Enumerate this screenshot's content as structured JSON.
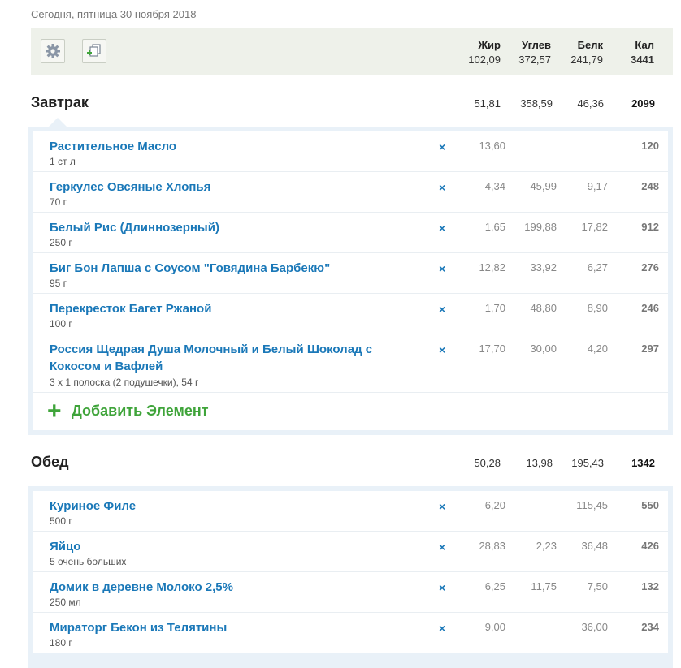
{
  "date": "Сегодня, пятница 30 ноября 2018",
  "toolbar": {
    "settings_icon": "gear-icon",
    "copy_icon": "copy-plus-icon"
  },
  "totals": {
    "headers": {
      "fat": "Жир",
      "carb": "Углев",
      "prot": "Белк",
      "kcal": "Кал"
    },
    "fat": "102,09",
    "carb": "372,57",
    "prot": "241,79",
    "kcal": "3441"
  },
  "breakfast": {
    "title": "Завтрак",
    "fat": "51,81",
    "carb": "358,59",
    "prot": "46,36",
    "kcal": "2099",
    "items": [
      {
        "name": "Растительное Масло",
        "amount": "1 ст л",
        "fat": "13,60",
        "carb": "",
        "prot": "",
        "kcal": "120"
      },
      {
        "name": "Геркулес Овсяные Хлопья",
        "amount": "70 г",
        "fat": "4,34",
        "carb": "45,99",
        "prot": "9,17",
        "kcal": "248"
      },
      {
        "name": "Белый Рис (Длиннозерный)",
        "amount": "250 г",
        "fat": "1,65",
        "carb": "199,88",
        "prot": "17,82",
        "kcal": "912"
      },
      {
        "name": "Биг Бон Лапша с Соусом \"Говядина Барбекю\"",
        "amount": "95 г",
        "fat": "12,82",
        "carb": "33,92",
        "prot": "6,27",
        "kcal": "276"
      },
      {
        "name": "Перекресток Багет Ржаной",
        "amount": "100 г",
        "fat": "1,70",
        "carb": "48,80",
        "prot": "8,90",
        "kcal": "246"
      },
      {
        "name": "Россия Щедрая Душа Молочный и Белый Шоколад с Кокосом и Вафлей",
        "amount": "3 x 1 полоска (2 подушечки), 54 г",
        "fat": "17,70",
        "carb": "30,00",
        "prot": "4,20",
        "kcal": "297"
      }
    ],
    "add_label": "Добавить Элемент"
  },
  "lunch": {
    "title": "Обед",
    "fat": "50,28",
    "carb": "13,98",
    "prot": "195,43",
    "kcal": "1342",
    "items": [
      {
        "name": "Куриное Филе",
        "amount": "500 г",
        "fat": "6,20",
        "carb": "",
        "prot": "115,45",
        "kcal": "550"
      },
      {
        "name": "Яйцо",
        "amount": "5 очень больших",
        "fat": "28,83",
        "carb": "2,23",
        "prot": "36,48",
        "kcal": "426"
      },
      {
        "name": "Домик в деревне Молоко 2,5%",
        "amount": "250 мл",
        "fat": "6,25",
        "carb": "11,75",
        "prot": "7,50",
        "kcal": "132"
      },
      {
        "name": "Мираторг Бекон из Телятины",
        "amount": "180 г",
        "fat": "9,00",
        "carb": "",
        "prot": "36,00",
        "kcal": "234"
      }
    ]
  },
  "delete_glyph": "×"
}
